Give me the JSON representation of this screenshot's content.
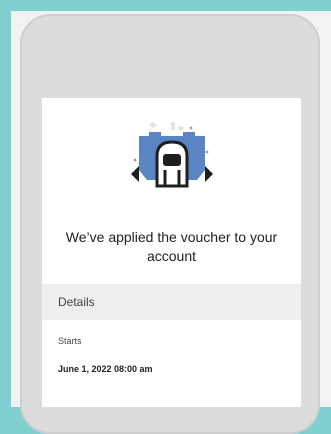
{
  "confirmation": {
    "headline": "We’ve applied the voucher to your account",
    "illustration_icon": "voucher-shield-icon"
  },
  "details": {
    "section_title": "Details",
    "starts_label": "Starts",
    "starts_value": "June 1, 2022 08:00 am"
  },
  "colors": {
    "frame": "#7fd0cf",
    "accent": "#5b84c4"
  }
}
